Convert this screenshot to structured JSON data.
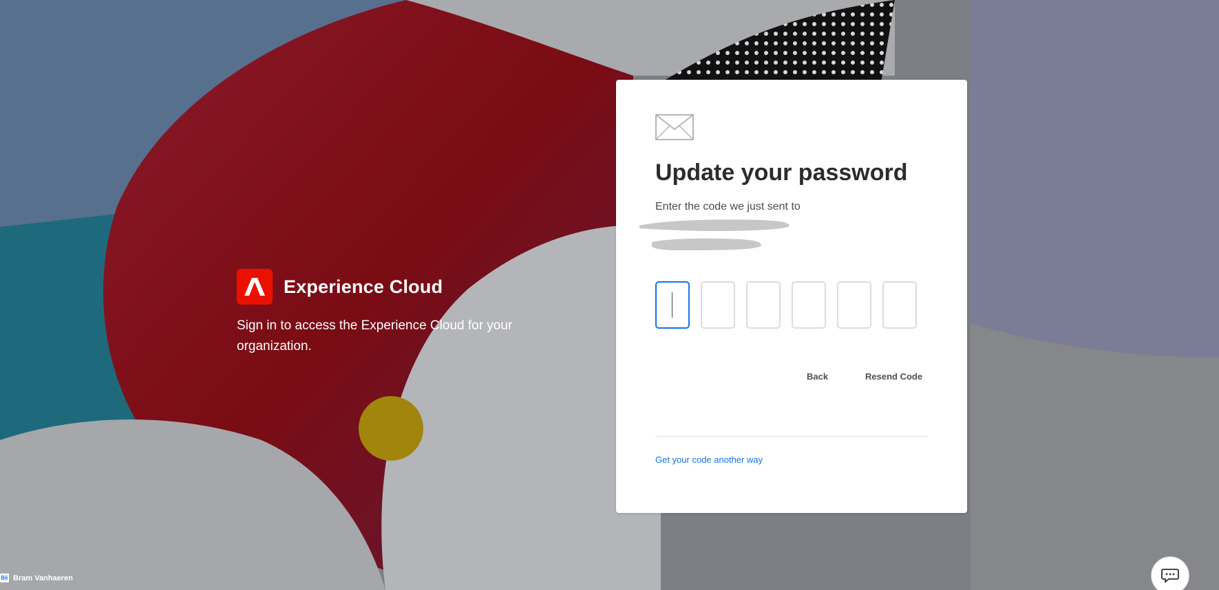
{
  "brand": {
    "name": "Experience Cloud",
    "tagline": "Sign in to access the Experience Cloud for your organization.",
    "logo_color": "#eb1000"
  },
  "card": {
    "title": "Update your password",
    "subtitle": "Enter the code we just sent to",
    "code_inputs": [
      "",
      "",
      "",
      "",
      "",
      ""
    ],
    "back_label": "Back",
    "resend_label": "Resend Code",
    "alt_link": "Get your code another way",
    "accent_color": "#1473e6"
  },
  "footer": {
    "badge": "Bē",
    "credit": "Bram Vanhaeren"
  },
  "icons": {
    "mail": "envelope-icon",
    "chat": "chat-icon",
    "logo": "adobe-logo-icon"
  }
}
